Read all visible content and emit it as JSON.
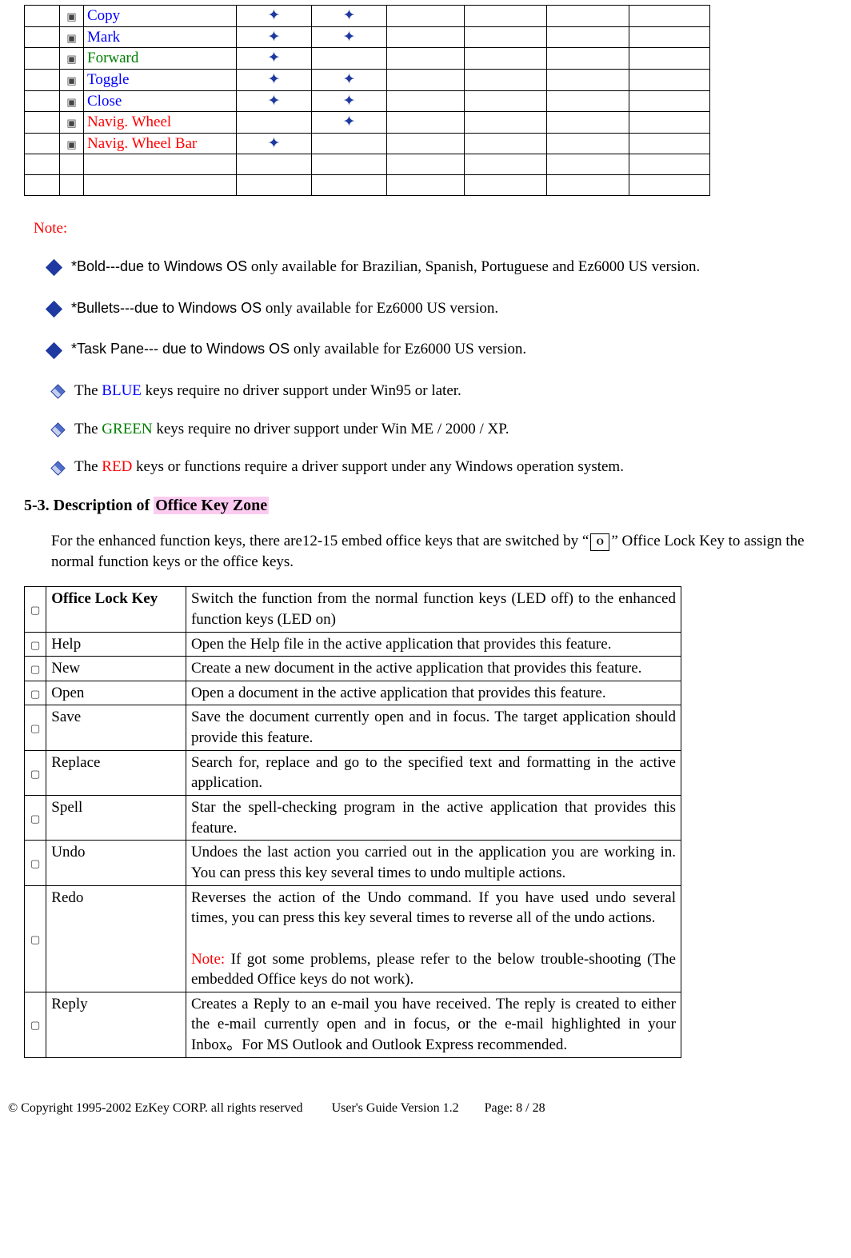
{
  "top_rows": [
    {
      "icon": "copy-icon",
      "label": "Copy",
      "cls": "blue",
      "m3": "✦",
      "m4": "✦"
    },
    {
      "icon": "mark-icon",
      "label": "Mark",
      "cls": "blue",
      "m3": "✦",
      "m4": "✦"
    },
    {
      "icon": "forward-icon",
      "label": "Forward",
      "cls": "green",
      "m3": "✦",
      "m4": ""
    },
    {
      "icon": "toggle-icon",
      "label": "Toggle",
      "cls": "blue",
      "m3": "✦",
      "m4": "✦"
    },
    {
      "icon": "close-icon",
      "label": "Close",
      "cls": "blue",
      "m3": "✦",
      "m4": "✦"
    },
    {
      "icon": "navwheel-icon",
      "label": "Navig. Wheel",
      "cls": "red",
      "m3": "",
      "m4": "✦"
    },
    {
      "icon": "navwheelbar-icon",
      "label": "Navig. Wheel Bar",
      "cls": "red",
      "m3": "✦",
      "m4": ""
    },
    {
      "icon": "",
      "label": "",
      "cls": "",
      "m3": "",
      "m4": ""
    },
    {
      "icon": "",
      "label": "",
      "cls": "",
      "m3": "",
      "m4": ""
    }
  ],
  "note_label": "Note:",
  "notes": [
    {
      "size": "l",
      "pre": "*Bold---due to Windows OS",
      "pre_cls": "arial",
      "rest": " only available for Brazilian, Spanish, Portuguese and Ez6000 US version."
    },
    {
      "size": "l",
      "pre": "*Bullets---due to Windows OS",
      "pre_cls": "arial",
      "rest": " only available for Ez6000 US version."
    },
    {
      "size": "l",
      "pre": "*Task Pane--- due to Windows OS",
      "pre_cls": "arial",
      "rest": " only available for Ez6000 US version."
    },
    {
      "size": "s",
      "pre": "The  ",
      "key": "BLUE",
      "key_cls": "blue",
      "rest": " keys require no driver support under Win95 or later."
    },
    {
      "size": "s",
      "pre": "The  ",
      "key": "GREEN",
      "key_cls": "green",
      "rest": " keys require no driver support under Win ME / 2000 / XP."
    },
    {
      "size": "s",
      "pre": "The  ",
      "key": "RED",
      "key_cls": "red",
      "rest": " keys or functions require a driver support under any Windows operation system."
    }
  ],
  "section_heading_a": "5-3. Description of ",
  "section_heading_b": "Office Key Zone",
  "para_a": "For the enhanced function keys, there are12-15 embed office keys that are switched by “",
  "para_b": "” Office Lock Key to assign the normal function keys or the office keys.",
  "office_rows": [
    {
      "icon": "olock-icon",
      "name": "Office Lock Key",
      "name_bold": true,
      "desc": "Switch the function from the normal function keys (LED off) to the enhanced function keys (LED on)"
    },
    {
      "icon": "help-icon",
      "name": "Help",
      "desc": "Open the Help file in the active application that provides this feature."
    },
    {
      "icon": "new-icon",
      "name": "New",
      "desc": "Create a new document in the active application that provides this feature."
    },
    {
      "icon": "open-icon",
      "name": "Open",
      "desc": "Open a document in the active application that provides this feature."
    },
    {
      "icon": "save-icon",
      "name": "Save",
      "desc": "Save the document currently open and in focus. The target application should provide this feature."
    },
    {
      "icon": "replace-icon",
      "name": "Replace",
      "desc": "Search for, replace and go to the specified text and formatting in the active application."
    },
    {
      "icon": "spell-icon",
      "name": "Spell",
      "desc": "Star the spell-checking program in the active application that provides this feature."
    },
    {
      "icon": "undo-icon",
      "name": "Undo",
      "desc": "Undoes the last action you carried out in the application you are working in. You can press this key several times to undo multiple actions."
    },
    {
      "icon": "redo-icon",
      "name": "Redo",
      "desc": "Reverses the action of the Undo command. If you have used undo several times, you can press this key several times to reverse all of the undo actions.",
      "note_pre": "Note:",
      "note_rest": " If got some problems, please refer to the below trouble-shooting (The embedded Office keys do not work)."
    },
    {
      "icon": "reply-icon",
      "name": "Reply",
      "desc": "Creates a Reply to an e-mail you have received. The reply is created to either the e-mail currently open and in focus, or the e-mail highlighted in your Inbox。For MS Outlook and Outlook Express recommended."
    }
  ],
  "footer_left": "© Copyright 1995-2002 EzKey CORP. all rights reserved",
  "footer_mid": "User's Guide Version 1.2",
  "footer_right": "Page:  8 / 28"
}
